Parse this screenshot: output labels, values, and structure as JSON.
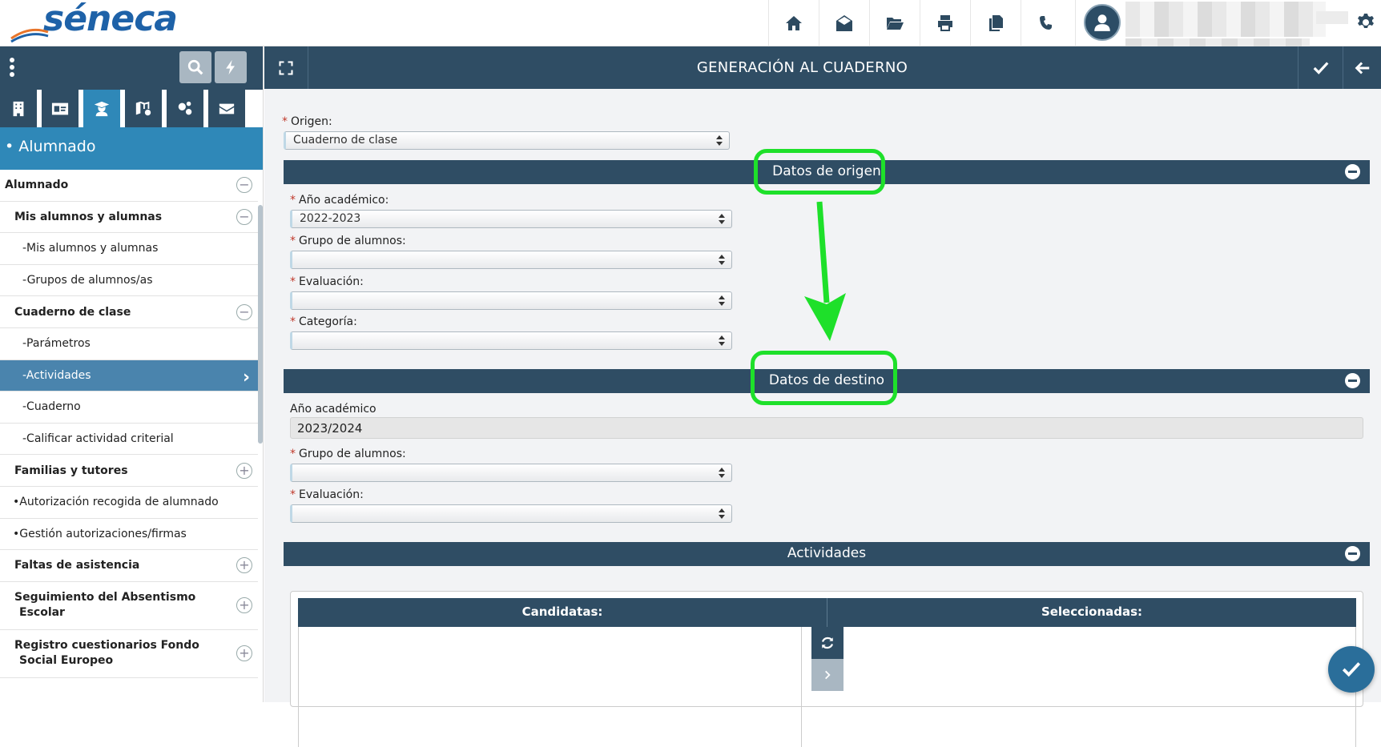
{
  "brand": {
    "logo_text": "séneca"
  },
  "topbar": {
    "icons": [
      "home-icon",
      "mail-icon",
      "folder-icon",
      "print-icon",
      "copy-icon",
      "phone-icon"
    ]
  },
  "sidebar": {
    "section_title": "• Alumnado",
    "menu": [
      {
        "label": "Alumnado",
        "level": 0,
        "toggle": "−"
      },
      {
        "label": "Mis alumnos y alumnas",
        "level": 1,
        "toggle": "−"
      },
      {
        "label": "-Mis alumnos y alumnas",
        "level": 2
      },
      {
        "label": "-Grupos de alumnos/as",
        "level": 2
      },
      {
        "label": "Cuaderno de clase",
        "level": 1,
        "toggle": "−"
      },
      {
        "label": "-Parámetros",
        "level": 2
      },
      {
        "label": "-Actividades",
        "level": 2,
        "selected": true
      },
      {
        "label": "-Cuaderno",
        "level": 2
      },
      {
        "label": "-Calificar actividad criterial",
        "level": 2
      },
      {
        "label": "Familias y tutores",
        "level": 1,
        "toggle": "+"
      },
      {
        "label": "•Autorización recogida de alumnado",
        "level": 3
      },
      {
        "label": "•Gestión autorizaciones/firmas",
        "level": 3
      },
      {
        "label": "Faltas de asistencia",
        "level": 1,
        "toggle": "+"
      },
      {
        "label": "Seguimiento del Absentismo",
        "label2": "Escolar",
        "level": 1,
        "toggle": "+",
        "tall": true
      },
      {
        "label": "Registro cuestionarios Fondo",
        "label2": "Social Europeo",
        "level": 1,
        "toggle": "+",
        "tall": true
      }
    ]
  },
  "main": {
    "title": "GENERACIÓN AL CUADERNO",
    "origen_label": "Origen:",
    "origen_value": "Cuaderno de clase",
    "datos_origen": {
      "title": "Datos de origen",
      "anio_label": "Año académico:",
      "anio_value": "2022-2023",
      "grupo_label": "Grupo de alumnos:",
      "evaluacion_label": "Evaluación:",
      "categoria_label": "Categoría:"
    },
    "datos_destino": {
      "title": "Datos de destino",
      "anio_label": "Año académico",
      "anio_value": "2023/2024",
      "grupo_label": "Grupo de alumnos:",
      "evaluacion_label": "Evaluación:"
    },
    "actividades": {
      "title": "Actividades",
      "candidatas": "Candidatas:",
      "seleccionadas": "Seleccionadas:"
    }
  },
  "colors": {
    "header_dark": "#2f4d64",
    "accent_blue": "#2f88b8",
    "annotation_green": "#1ee02a"
  }
}
